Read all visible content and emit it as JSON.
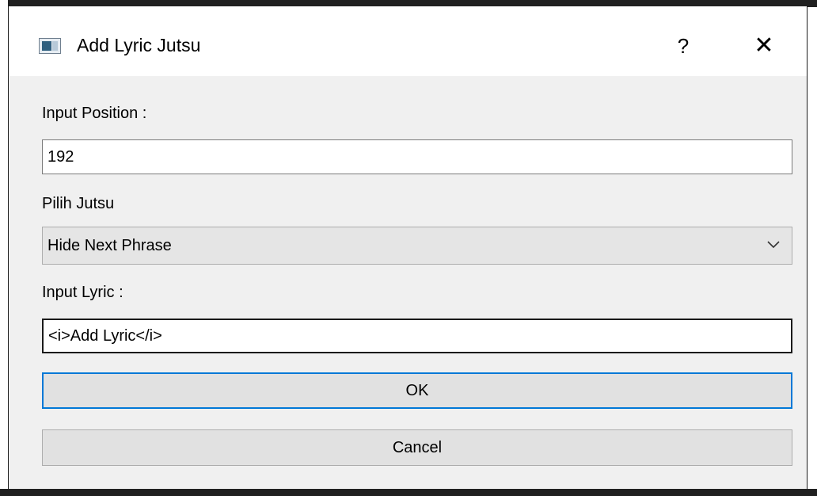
{
  "window": {
    "title": "Add Lyric Jutsu",
    "help_label": "?",
    "close_label": "✕"
  },
  "form": {
    "position_label": "Input Position :",
    "position_value": "192",
    "jutsu_label": "Pilih Jutsu",
    "jutsu_selected": "Hide Next Phrase",
    "lyric_label": "Input Lyric :",
    "lyric_value": "<i>Add Lyric</i>"
  },
  "buttons": {
    "ok": "OK",
    "cancel": "Cancel"
  },
  "colors": {
    "focus_accent": "#0078d7",
    "dialog_bg": "#f0f0f0"
  }
}
